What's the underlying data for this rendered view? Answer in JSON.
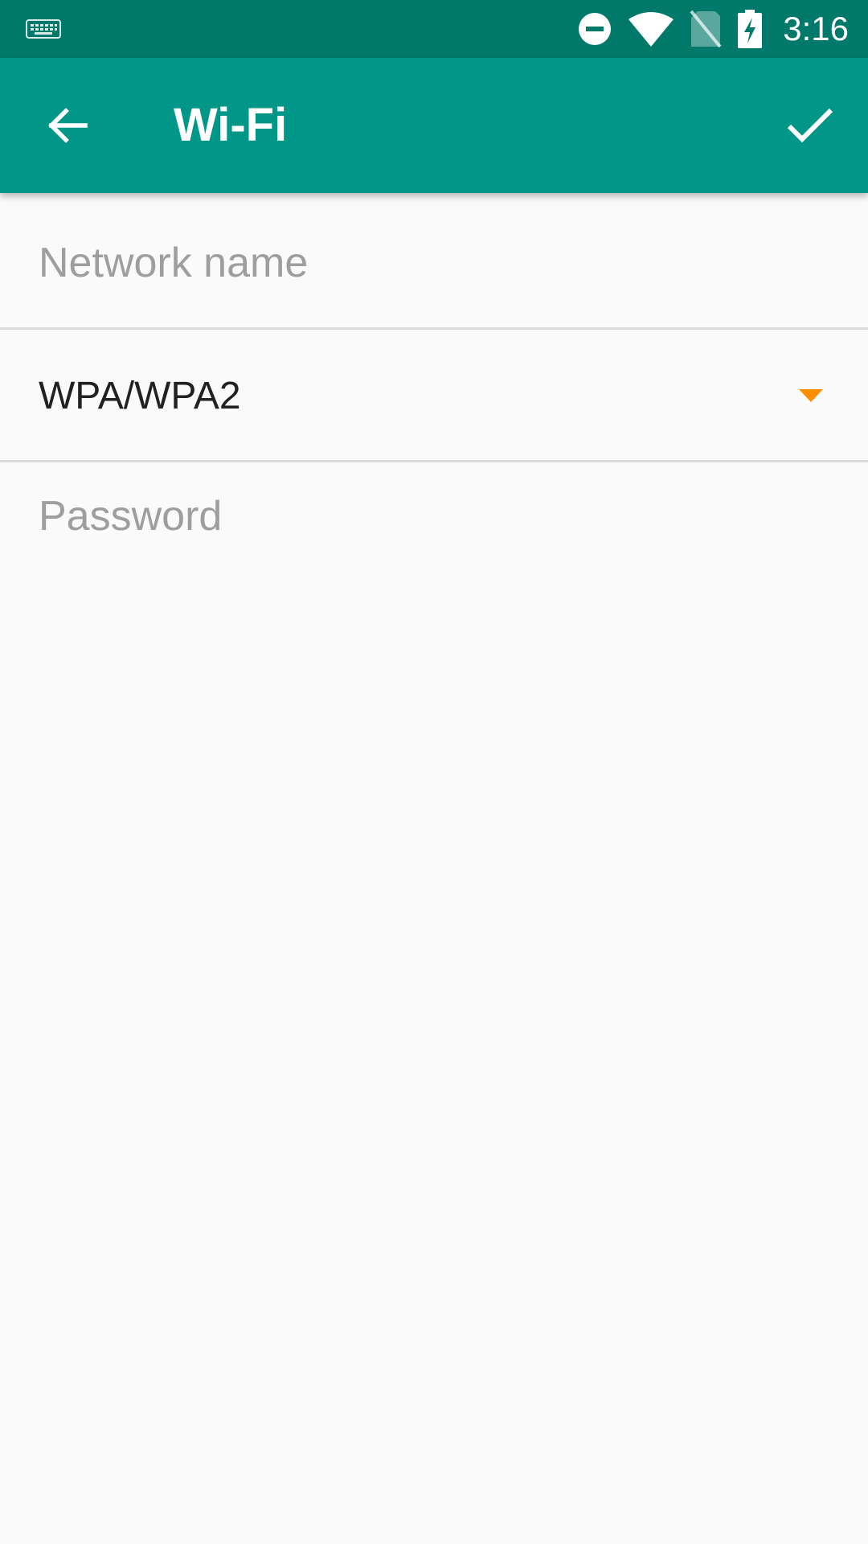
{
  "status_bar": {
    "time": "3:16",
    "icons": [
      "keyboard-icon",
      "do-not-disturb-icon",
      "wifi-icon",
      "no-sim-icon",
      "battery-charging-icon"
    ]
  },
  "app_bar": {
    "title": "Wi-Fi",
    "back_icon": "arrow-back-icon",
    "save_icon": "check-icon"
  },
  "form": {
    "network_name": {
      "value": "",
      "placeholder": "Network name"
    },
    "security": {
      "selected": "WPA/WPA2"
    },
    "password": {
      "value": "",
      "placeholder": "Password"
    }
  },
  "colors": {
    "status_bar": "#00796b",
    "app_bar": "#009688",
    "accent": "#ff8f00",
    "background": "#fafafa"
  }
}
